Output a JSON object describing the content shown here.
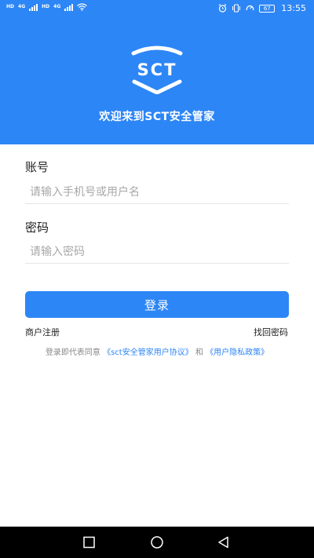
{
  "status_bar": {
    "sim1": "HD",
    "sim2": "HD",
    "net1": "4G",
    "net2": "4G",
    "battery": "67",
    "time": "13:55"
  },
  "header": {
    "logo_text": "SCT",
    "welcome": "欢迎来到SCT安全管家",
    "background_color": "#2d86f5"
  },
  "form": {
    "account_label": "账号",
    "account_placeholder": "请输入手机号或用户名",
    "account_value": "",
    "password_label": "密码",
    "password_placeholder": "请输入密码",
    "password_value": "",
    "login_label": "登录",
    "register_link": "商户注册",
    "recover_link": "找回密码"
  },
  "agreement": {
    "prefix": "登录即代表同意",
    "user_agreement": "《sct安全管家用户协议》",
    "conjunction": "和",
    "privacy_policy": "《用户隐私政策》"
  },
  "nav": {
    "recent_icon": "square-icon",
    "home_icon": "circle-icon",
    "back_icon": "triangle-back-icon"
  }
}
